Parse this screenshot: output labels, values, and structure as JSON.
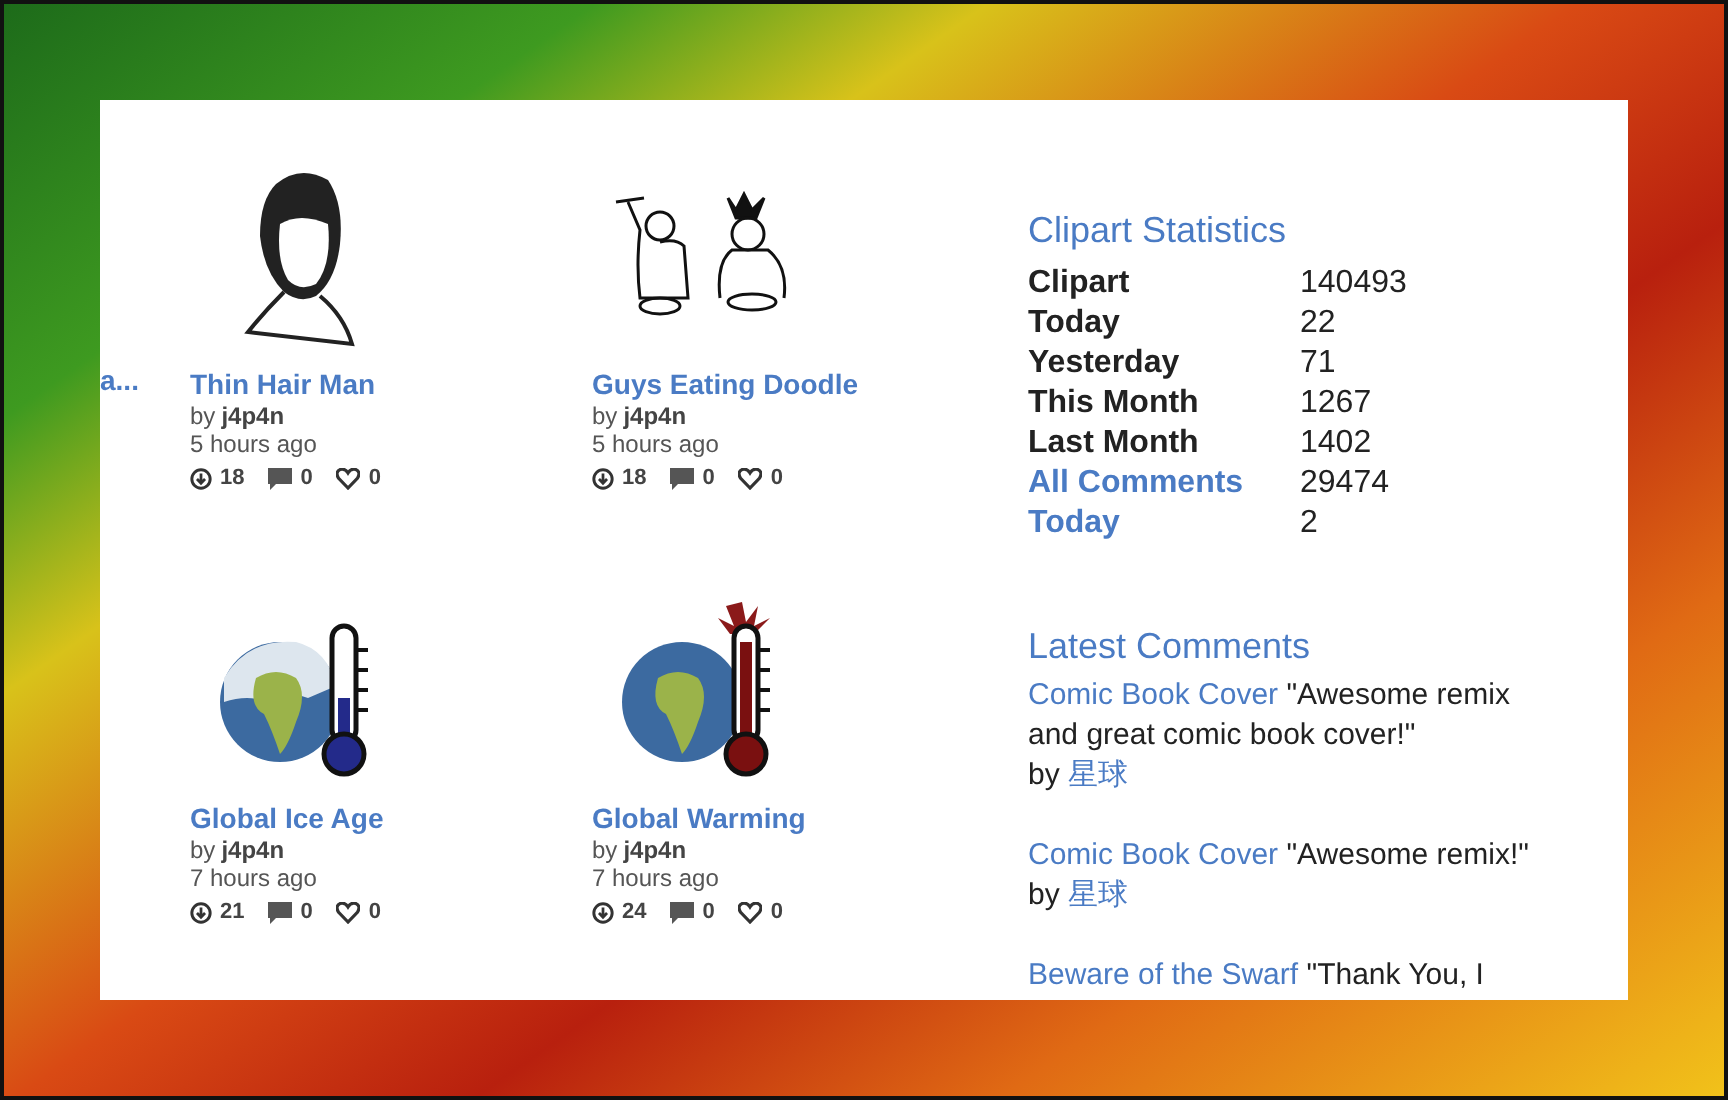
{
  "partial_card": {
    "title": "a..."
  },
  "cards": [
    {
      "kind": "portrait",
      "title": "Thin Hair Man",
      "by": "by",
      "author": "j4p4n",
      "time": "5 hours ago",
      "downloads": "18",
      "comments": "0",
      "likes": "0"
    },
    {
      "kind": "doodle",
      "title": "Guys Eating Doodle",
      "by": "by",
      "author": "j4p4n",
      "time": "5 hours ago",
      "downloads": "18",
      "comments": "0",
      "likes": "0"
    },
    {
      "kind": "globe-cold",
      "title": "Global Ice Age",
      "by": "by",
      "author": "j4p4n",
      "time": "7 hours ago",
      "downloads": "21",
      "comments": "0",
      "likes": "0"
    },
    {
      "kind": "globe-hot",
      "title": "Global Warming",
      "by": "by",
      "author": "j4p4n",
      "time": "7 hours ago",
      "downloads": "24",
      "comments": "0",
      "likes": "0"
    }
  ],
  "statistics": {
    "title": "Clipart Statistics",
    "rows": [
      {
        "kind": "plain",
        "label": "Clipart",
        "value": "140493"
      },
      {
        "kind": "plain",
        "label": "Today",
        "value": "22"
      },
      {
        "kind": "plain",
        "label": "Yesterday",
        "value": "71"
      },
      {
        "kind": "plain",
        "label": "This Month",
        "value": "1267"
      },
      {
        "kind": "plain",
        "label": "Last Month",
        "value": "1402"
      },
      {
        "kind": "link",
        "label": "All Comments",
        "value": "29474"
      },
      {
        "kind": "link",
        "label": "Today",
        "value": "2"
      }
    ]
  },
  "latest_comments": {
    "title": "Latest Comments",
    "items": [
      {
        "clipart": "Comic Book Cover",
        "text": "\"Awesome remix and great comic book cover!\"",
        "by": "by",
        "author": "星球"
      },
      {
        "clipart": "Comic Book Cover",
        "text": "\"Awesome remix!\"",
        "by": "by",
        "author": "星球"
      },
      {
        "clipart": "Beware of the Swarf",
        "text": "\"Thank You, I"
      }
    ]
  }
}
